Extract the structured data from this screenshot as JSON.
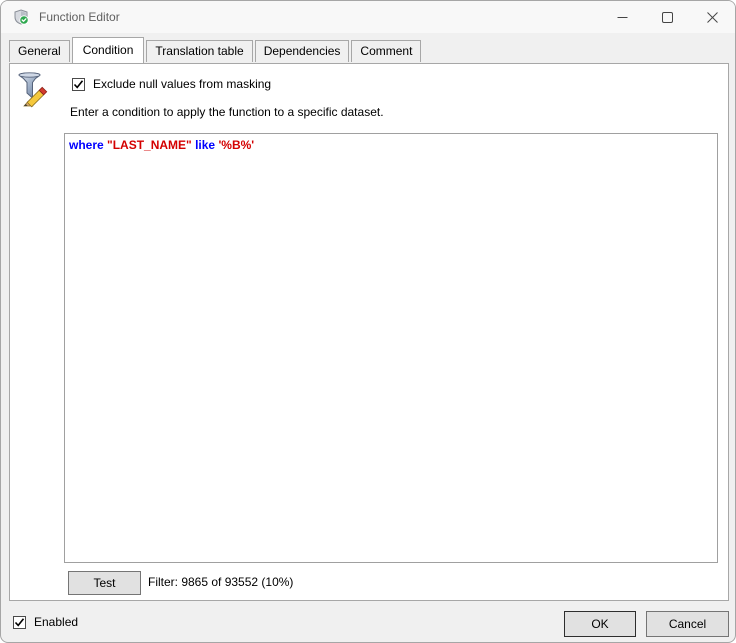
{
  "window": {
    "title": "Function Editor",
    "controls": [
      {
        "name": "minimize"
      },
      {
        "name": "maximize"
      },
      {
        "name": "close"
      }
    ]
  },
  "tabs": [
    {
      "label": "General",
      "active": false
    },
    {
      "label": "Condition",
      "active": true
    },
    {
      "label": "Translation table",
      "active": false
    },
    {
      "label": "Dependencies",
      "active": false
    },
    {
      "label": "Comment",
      "active": false
    }
  ],
  "condition_tab": {
    "exclude_null_checkbox": {
      "label": "Exclude null values from masking",
      "checked": true
    },
    "instruction": "Enter a condition to apply the function to a specific dataset.",
    "editor": {
      "language": "sql",
      "tokens": [
        {
          "text": "where",
          "type": "keyword"
        },
        {
          "text": " \"LAST_NAME\"",
          "type": "string"
        },
        {
          "text": " like",
          "type": "keyword"
        },
        {
          "text": " '%B%'",
          "type": "string"
        }
      ]
    },
    "test_button_label": "Test",
    "filter_status": "Filter: 9865 of 93552 (10%)"
  },
  "footer": {
    "enabled_checkbox": {
      "label": "Enabled",
      "checked": true
    },
    "ok_label": "OK",
    "cancel_label": "Cancel"
  },
  "colors": {
    "keyword": "#0000ff",
    "string": "#d40000",
    "badge_green": "#2fa84f",
    "dialog_bg": "#f0f0f0"
  }
}
